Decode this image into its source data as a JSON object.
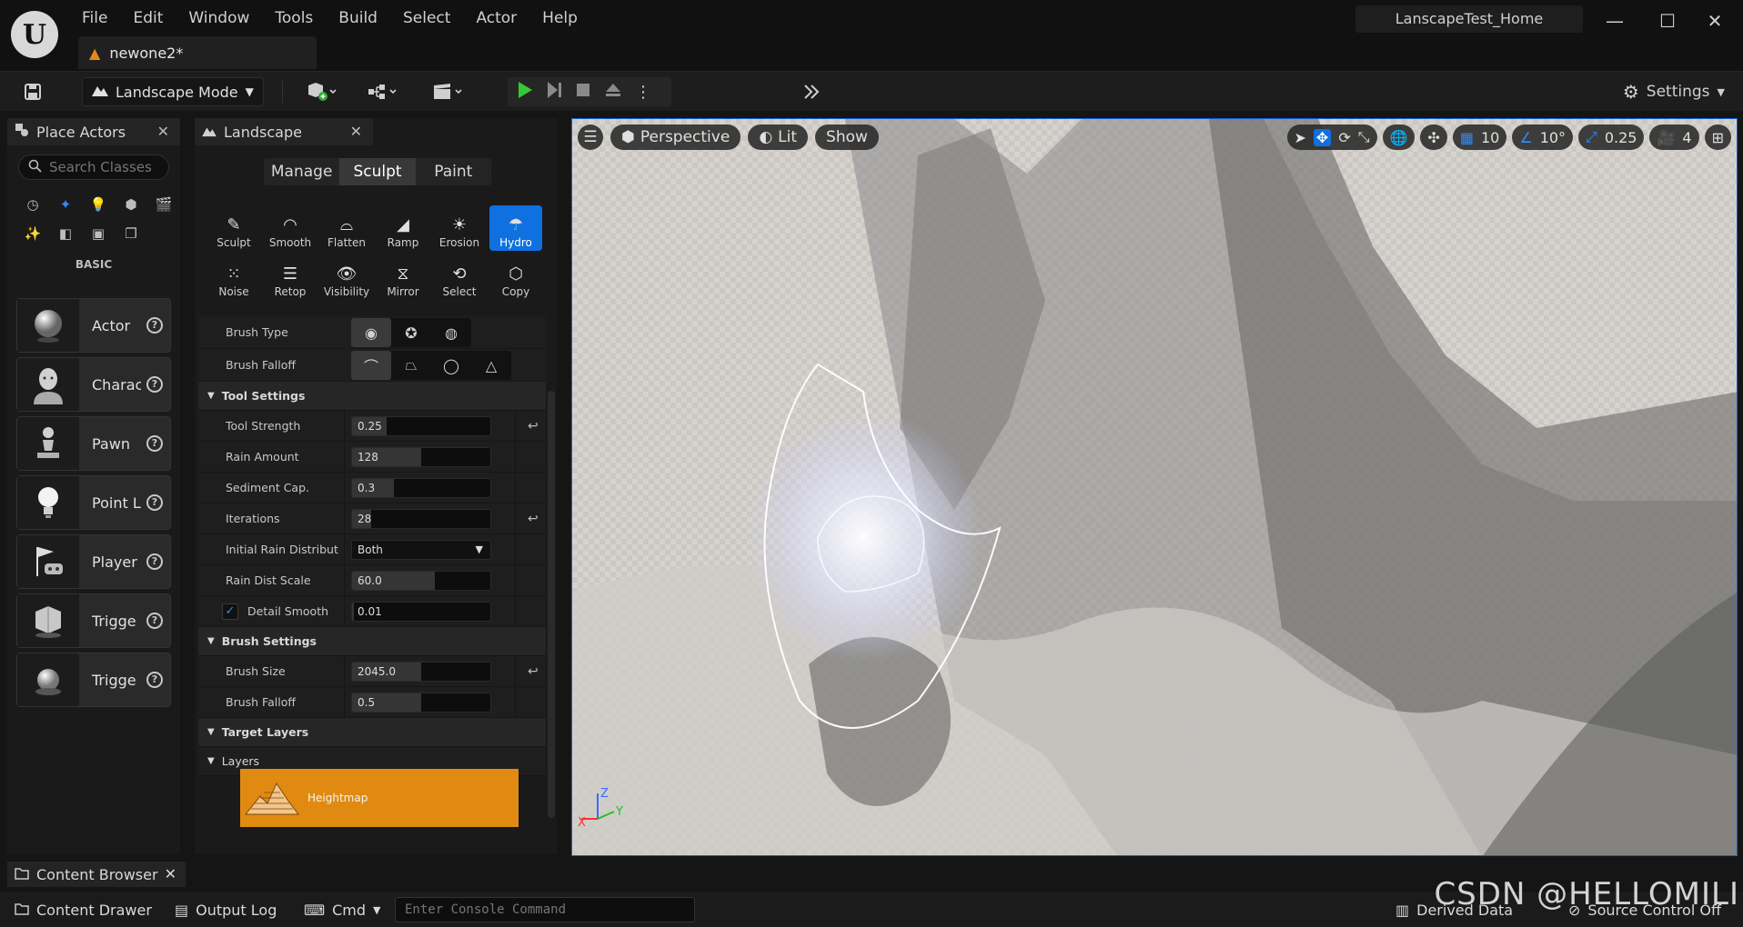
{
  "app": {
    "project_name": "LanscapeTest_Home",
    "document_tab": "newone2*",
    "menu": [
      "File",
      "Edit",
      "Window",
      "Tools",
      "Build",
      "Select",
      "Actor",
      "Help"
    ],
    "window_controls": {
      "minimize": "—",
      "maximize": "☐",
      "close": "✕"
    }
  },
  "toolbar": {
    "mode": "Landscape Mode",
    "settings_label": "Settings"
  },
  "place_actors": {
    "tab_label": "Place Actors",
    "search_placeholder": "Search Classes",
    "category_label": "BASIC",
    "actors": [
      {
        "label": "Actor",
        "icon": "sphere-icon"
      },
      {
        "label": "Charac",
        "icon": "character-icon"
      },
      {
        "label": "Pawn",
        "icon": "pawn-icon"
      },
      {
        "label": "Point L",
        "icon": "light-bulb-icon"
      },
      {
        "label": "Player",
        "icon": "player-start-icon"
      },
      {
        "label": "Trigge",
        "icon": "trigger-box-icon"
      },
      {
        "label": "Trigge",
        "icon": "trigger-sphere-icon"
      }
    ]
  },
  "landscape": {
    "tab_label": "Landscape",
    "modes": [
      "Manage",
      "Sculpt",
      "Paint"
    ],
    "active_mode": "Sculpt",
    "tools": [
      {
        "label": "Sculpt",
        "icon": "sculpt-icon"
      },
      {
        "label": "Smooth",
        "icon": "smooth-icon"
      },
      {
        "label": "Flatten",
        "icon": "flatten-icon"
      },
      {
        "label": "Ramp",
        "icon": "ramp-icon"
      },
      {
        "label": "Erosion",
        "icon": "erosion-icon"
      },
      {
        "label": "Hydro",
        "icon": "hydro-icon"
      },
      {
        "label": "Noise",
        "icon": "noise-icon"
      },
      {
        "label": "Retop",
        "icon": "retop-icon"
      },
      {
        "label": "Visibility",
        "icon": "visibility-icon"
      },
      {
        "label": "Mirror",
        "icon": "mirror-icon"
      },
      {
        "label": "Select",
        "icon": "select-icon"
      },
      {
        "label": "Copy",
        "icon": "copy-icon"
      }
    ],
    "active_tool": "Hydro",
    "brush_type_label": "Brush Type",
    "brush_falloff_label": "Brush Falloff",
    "tool_settings": {
      "title": "Tool Settings",
      "rows": [
        {
          "label": "Tool Strength",
          "value": "0.25",
          "level": 0.25,
          "reset": true
        },
        {
          "label": "Rain Amount",
          "value": "128",
          "level": 0.5,
          "reset": false
        },
        {
          "label": "Sediment Cap.",
          "value": "0.3",
          "level": 0.3,
          "reset": false
        },
        {
          "label": "Iterations",
          "value": "28",
          "level": 0.14,
          "reset": true
        },
        {
          "label": "Initial Rain Distributi...",
          "value": "Both",
          "dropdown": true
        },
        {
          "label": "Rain Dist Scale",
          "value": "60.0",
          "level": 0.6,
          "reset": false
        },
        {
          "label": "Detail Smooth",
          "value": "0.01",
          "level": 0.01,
          "checkbox": true
        }
      ]
    },
    "brush_settings": {
      "title": "Brush Settings",
      "rows": [
        {
          "label": "Brush Size",
          "value": "2045.0",
          "level": 0.5,
          "reset": true
        },
        {
          "label": "Brush Falloff",
          "value": "0.5",
          "level": 0.5,
          "reset": false
        }
      ]
    },
    "target_layers_title": "Target Layers",
    "layers_title": "Layers",
    "layer_name": "Heightmap"
  },
  "viewport": {
    "view_mode": "Perspective",
    "lighting": "Lit",
    "show": "Show",
    "grid_snap": "10",
    "rotation_snap": "10°",
    "scale_snap": "0.25",
    "camera_speed": "4"
  },
  "bottom": {
    "content_browser": "Content Browser",
    "content_drawer": "Content Drawer",
    "output_log": "Output Log",
    "cmd": "Cmd",
    "console_placeholder": "Enter Console Command",
    "derived_data": "Derived Data",
    "source_control": "Source Control Off"
  },
  "watermark": "CSDN @HELLOMILI"
}
